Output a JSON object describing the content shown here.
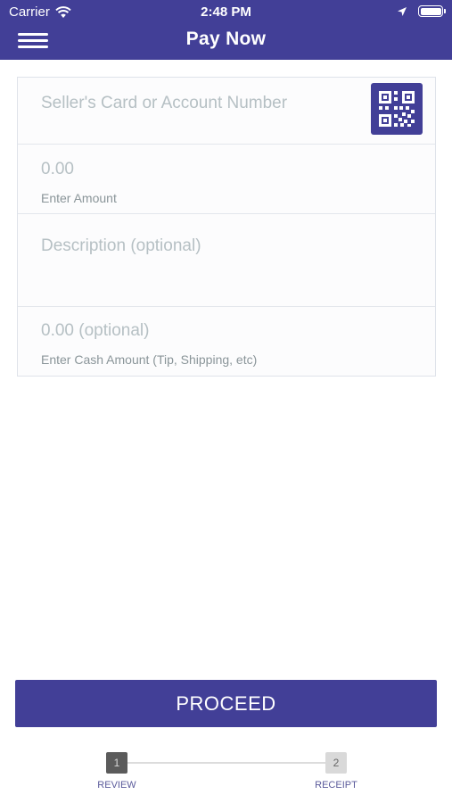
{
  "status_bar": {
    "carrier": "Carrier",
    "time": "2:48 PM",
    "icons": [
      "wifi-icon",
      "location-arrow-icon",
      "battery-icon"
    ]
  },
  "header": {
    "title": "Pay Now",
    "background_color": "#423f97",
    "menu_icon": "hamburger-menu-icon"
  },
  "form": {
    "seller_account": {
      "placeholder": "Seller's Card or Account Number",
      "scan_icon": "qr-code-icon"
    },
    "amount": {
      "value": "0.00",
      "label": "Enter Amount"
    },
    "description": {
      "placeholder": "Description (optional)"
    },
    "cash_amount": {
      "value": "0.00 (optional)",
      "label": "Enter Cash Amount (Tip, Shipping, etc)"
    }
  },
  "proceed_label": "PROCEED",
  "steps": [
    {
      "number": "1",
      "label": "REVIEW",
      "active": true
    },
    {
      "number": "2",
      "label": "RECEIPT",
      "active": false
    }
  ]
}
